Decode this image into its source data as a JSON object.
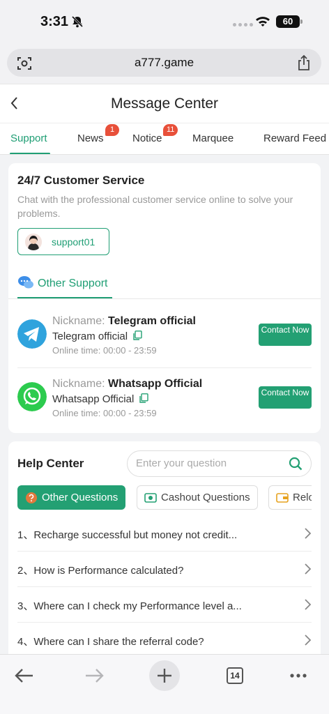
{
  "status_bar": {
    "time": "3:31",
    "battery": "60"
  },
  "browser": {
    "url": "a777.game",
    "tab_count": "14"
  },
  "header": {
    "title": "Message Center"
  },
  "tabs": [
    {
      "label": "Support",
      "badge": ""
    },
    {
      "label": "News",
      "badge": "1"
    },
    {
      "label": "Notice",
      "badge": "11"
    },
    {
      "label": "Marquee",
      "badge": ""
    },
    {
      "label": "Reward Feed",
      "badge": ""
    }
  ],
  "service": {
    "title": "24/7 Customer Service",
    "description": "Chat with the professional customer service online to solve your problems.",
    "agent": "support01",
    "other_support_label": "Other Support",
    "contacts": [
      {
        "nickname_label": "Nickname:",
        "nickname": "Telegram official",
        "account": "Telegram official",
        "online_time": "Online time: 00:00 - 23:59",
        "button": "Contact Now"
      },
      {
        "nickname_label": "Nickname:",
        "nickname": "Whatsapp Official",
        "account": "Whatsapp Official",
        "online_time": "Online time: 00:00 - 23:59",
        "button": "Contact Now"
      }
    ]
  },
  "help": {
    "title": "Help Center",
    "search_placeholder": "Enter your question",
    "categories": [
      "Other Questions",
      "Cashout Questions",
      "Reload Questions"
    ],
    "questions": [
      "1、Recharge successful but money not credit...",
      "2、How is Performance calculated?",
      "3、Where can I check my Performance level a...",
      "4、Where can I share the referral code?"
    ]
  },
  "colors": {
    "accent": "#1f9e74",
    "badge": "#e8503a"
  }
}
